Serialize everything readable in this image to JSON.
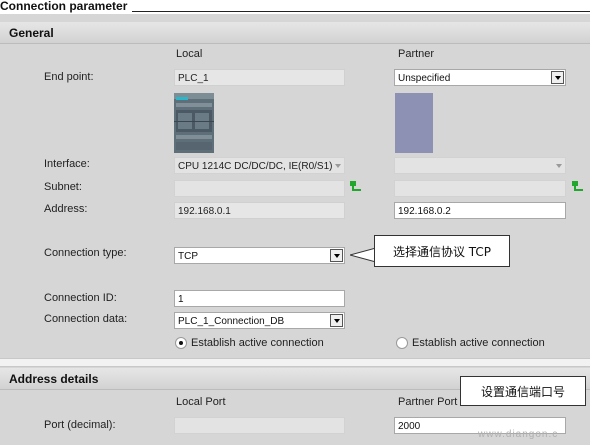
{
  "header": {
    "title": "Connection parameter"
  },
  "general": {
    "section_title": "General",
    "col_local": "Local",
    "col_partner": "Partner",
    "end_point": {
      "label": "End point:",
      "local": "PLC_1",
      "partner": "Unspecified"
    },
    "interface": {
      "label": "Interface:",
      "local": "CPU 1214C DC/DC/DC, IE(R0/S1)",
      "partner": ""
    },
    "subnet": {
      "label": "Subnet:",
      "local": "",
      "partner": ""
    },
    "address": {
      "label": "Address:",
      "local": "192.168.0.1",
      "partner": "192.168.0.2"
    },
    "connection_type": {
      "label": "Connection type:",
      "value": "TCP",
      "callout": "选择通信协议 TCP"
    },
    "connection_id": {
      "label": "Connection ID:",
      "value": "1"
    },
    "connection_data": {
      "label": "Connection data:",
      "value": "PLC_1_Connection_DB"
    },
    "active_connection": {
      "local_label": "Establish active connection",
      "local_selected": true,
      "partner_label": "Establish active connection",
      "partner_selected": false
    }
  },
  "address_details": {
    "section_title": "Address details",
    "col_local": "Local Port",
    "col_partner": "Partner Port",
    "port": {
      "label": "Port (decimal):",
      "local": "",
      "partner": "2000"
    },
    "callout": "设置通信端口号"
  },
  "watermark": "www.diangon.c",
  "colors": {
    "background": "#d6d6d6",
    "field_white": "#ffffff",
    "field_gray": "#e6e6e6",
    "partner_device": "#8d92b4",
    "net_icon": "#1fa82c"
  }
}
